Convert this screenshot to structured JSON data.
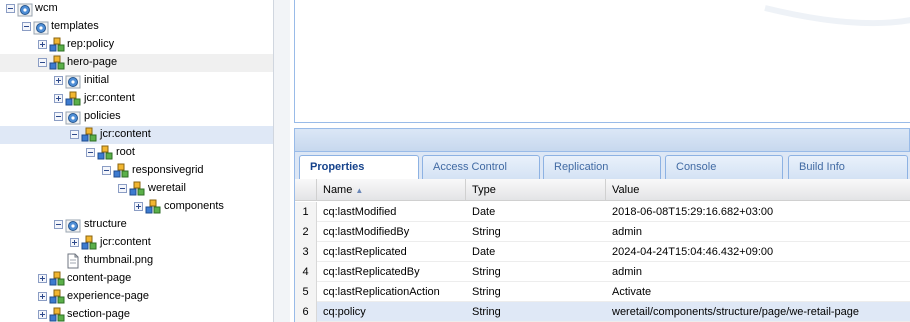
{
  "tree": {
    "nodes": [
      {
        "label": "wcm",
        "icon": "folder-globe-icon",
        "toggle": "minus"
      },
      {
        "label": "templates",
        "icon": "folder-globe-icon",
        "toggle": "minus"
      },
      {
        "label": "rep:policy",
        "icon": "node-cubes-icon",
        "toggle": "plus"
      },
      {
        "label": "hero-page",
        "icon": "node-cubes-icon",
        "toggle": "minus"
      },
      {
        "label": "initial",
        "icon": "folder-globe-icon",
        "toggle": "plus"
      },
      {
        "label": "jcr:content",
        "icon": "node-cubes-icon",
        "toggle": "plus"
      },
      {
        "label": "policies",
        "icon": "folder-globe-icon",
        "toggle": "minus"
      },
      {
        "label": "jcr:content",
        "icon": "node-cubes-icon",
        "toggle": "minus"
      },
      {
        "label": "root",
        "icon": "node-cubes-icon",
        "toggle": "minus"
      },
      {
        "label": "responsivegrid",
        "icon": "node-cubes-icon",
        "toggle": "minus"
      },
      {
        "label": "weretail",
        "icon": "node-cubes-icon",
        "toggle": "minus"
      },
      {
        "label": "components",
        "icon": "node-cubes-icon",
        "toggle": "plus"
      },
      {
        "label": "structure",
        "icon": "folder-globe-icon",
        "toggle": "minus"
      },
      {
        "label": "jcr:content",
        "icon": "node-cubes-icon",
        "toggle": "plus"
      },
      {
        "label": "thumbnail.png",
        "icon": "file-icon",
        "toggle": "none"
      },
      {
        "label": "content-page",
        "icon": "node-cubes-icon",
        "toggle": "plus"
      },
      {
        "label": "experience-page",
        "icon": "node-cubes-icon",
        "toggle": "plus"
      },
      {
        "label": "section-page",
        "icon": "node-cubes-icon",
        "toggle": "plus"
      }
    ]
  },
  "tabs": [
    "Properties",
    "Access Control",
    "Replication",
    "Console",
    "Build Info"
  ],
  "grid": {
    "columns": [
      "Name",
      "Type",
      "Value"
    ],
    "rows": [
      {
        "num": "1",
        "name": "cq:lastModified",
        "type": "Date",
        "value": "2018-06-08T15:29:16.682+03:00"
      },
      {
        "num": "2",
        "name": "cq:lastModifiedBy",
        "type": "String",
        "value": "admin"
      },
      {
        "num": "3",
        "name": "cq:lastReplicated",
        "type": "Date",
        "value": "2024-04-24T15:04:46.432+09:00"
      },
      {
        "num": "4",
        "name": "cq:lastReplicatedBy",
        "type": "String",
        "value": "admin"
      },
      {
        "num": "5",
        "name": "cq:lastReplicationAction",
        "type": "String",
        "value": "Activate"
      },
      {
        "num": "6",
        "name": "cq:policy",
        "type": "String",
        "value": "weretail/components/structure/page/we-retail-page"
      }
    ]
  },
  "colors": {
    "selection": "#dfe8f6",
    "accent": "#15428b",
    "tab_text": "#416aa3"
  }
}
